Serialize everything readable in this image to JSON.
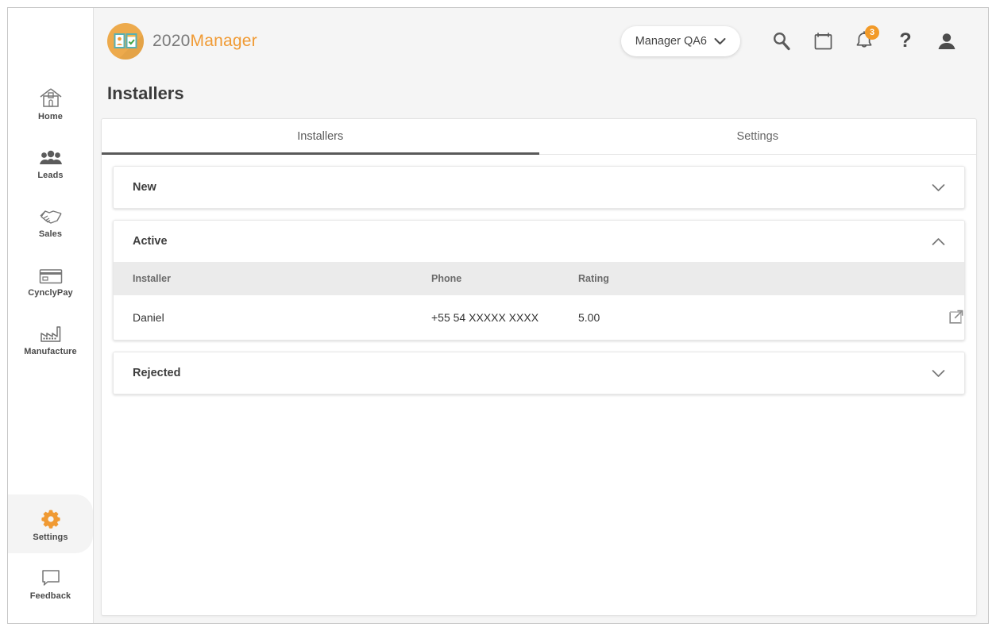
{
  "brand": {
    "name_part1": "2020",
    "name_part2": "Manager",
    "logo_icon": "id-card-checklist-icon",
    "accent_color": "#f09a33",
    "badge_color": "#edaa4c"
  },
  "header": {
    "user_menu_label": "Manager QA6",
    "user_menu_chevron": "chevron-down-icon",
    "icons": [
      {
        "name": "search-icon",
        "label": "Search"
      },
      {
        "name": "calendar-icon",
        "label": "Calendar"
      },
      {
        "name": "bell-icon",
        "label": "Notifications",
        "badge": "3"
      },
      {
        "name": "help-icon",
        "label": "Help"
      },
      {
        "name": "user-avatar-icon",
        "label": "Account"
      }
    ],
    "notification_count": "3",
    "notification_badge_color": "#f29a28"
  },
  "sidebar": {
    "items": [
      {
        "label": "Home",
        "icon": "home-icon",
        "active": false
      },
      {
        "label": "Leads",
        "icon": "people-icon",
        "active": false
      },
      {
        "label": "Sales",
        "icon": "handshake-icon",
        "active": false
      },
      {
        "label": "CynclyPay",
        "icon": "credit-card-icon",
        "active": false
      },
      {
        "label": "Manufacture",
        "icon": "factory-icon",
        "active": false
      }
    ],
    "bottom_items": [
      {
        "label": "Settings",
        "icon": "gear-icon",
        "active": true
      },
      {
        "label": "Feedback",
        "icon": "speech-bubble-icon",
        "active": false
      }
    ],
    "active_icon_color": "#f09a33"
  },
  "page": {
    "title": "Installers"
  },
  "tabs": [
    {
      "label": "Installers",
      "active": true
    },
    {
      "label": "Settings",
      "active": false
    }
  ],
  "accordions": [
    {
      "title": "New",
      "expanded": false,
      "chevron": "chevron-down-icon"
    },
    {
      "title": "Active",
      "expanded": true,
      "chevron": "chevron-up-icon"
    },
    {
      "title": "Rejected",
      "expanded": false,
      "chevron": "chevron-down-icon"
    }
  ],
  "table": {
    "columns": [
      "Installer",
      "Phone",
      "Rating",
      ""
    ],
    "rows": [
      {
        "installer": "Daniel",
        "phone": "+55 54 XXXXX XXXX",
        "rating": "5.00",
        "action_icon": "external-link-icon"
      }
    ]
  }
}
